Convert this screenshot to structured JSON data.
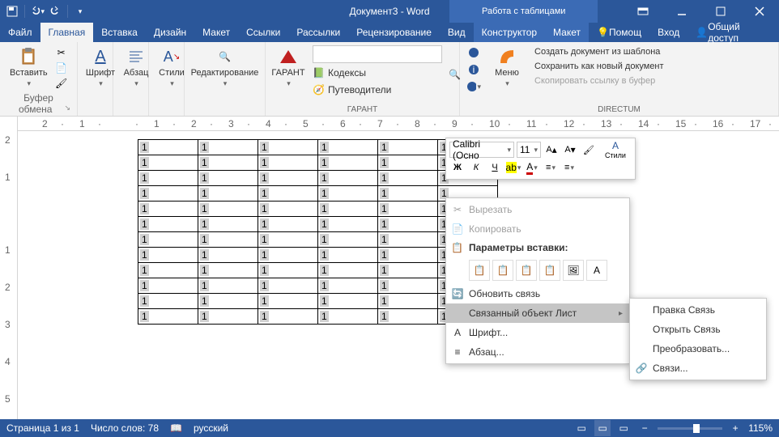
{
  "titlebar": {
    "title": "Документ3 - Word",
    "context_title": "Работа с таблицами"
  },
  "tabs": {
    "file": "Файл",
    "home": "Главная",
    "insert": "Вставка",
    "design": "Дизайн",
    "layout": "Макет",
    "refs": "Ссылки",
    "mailings": "Рассылки",
    "review": "Рецензирование",
    "view": "Вид",
    "constructor": "Конструктор",
    "tlayout": "Макет",
    "help": "Помощ",
    "login": "Вход",
    "share": "Общий доступ"
  },
  "ribbon": {
    "clipboard": {
      "label": "Буфер обмена",
      "paste": "Вставить"
    },
    "font": {
      "label": "Шрифт"
    },
    "para": {
      "label": "Абзац"
    },
    "styles": {
      "label": "Стили"
    },
    "editing": {
      "label": "Редактирование"
    },
    "garant": {
      "label": "ГАРАНТ",
      "btn": "ГАРАНТ",
      "kodeksy": "Кодексы",
      "guides": "Путеводители"
    },
    "directum": {
      "label": "DIRECTUM",
      "menu": "Меню",
      "create": "Создать документ из шаблона",
      "save_new": "Сохранить как новый документ",
      "copy_link": "Скопировать ссылку в буфер"
    }
  },
  "mini": {
    "font": "Calibri (Осно",
    "size": "11",
    "styles": "Стили",
    "bold": "Ж",
    "italic": "К",
    "underline": "Ч"
  },
  "ctx": {
    "cut": "Вырезать",
    "copy": "Копировать",
    "paste_header": "Параметры вставки:",
    "update": "Обновить связь",
    "linked": "Связанный объект Лист",
    "font_m": "Шрифт...",
    "para_m": "Абзац..."
  },
  "submenu": {
    "edit": "Правка Связь",
    "open": "Открыть Связь",
    "convert": "Преобразовать...",
    "links": "Связи..."
  },
  "status": {
    "page": "Страница 1 из 1",
    "words": "Число слов: 78",
    "lang": "русский",
    "zoom": "115%"
  },
  "chart_data": {
    "type": "table",
    "rows": 12,
    "cols": 6,
    "values": [
      [
        "1",
        "1",
        "1",
        "1",
        "1",
        "1"
      ],
      [
        "1",
        "1",
        "1",
        "1",
        "1",
        "1"
      ],
      [
        "1",
        "1",
        "1",
        "1",
        "1",
        "1"
      ],
      [
        "1",
        "1",
        "1",
        "1",
        "1",
        "1"
      ],
      [
        "1",
        "1",
        "1",
        "1",
        "1",
        "1"
      ],
      [
        "1",
        "1",
        "1",
        "1",
        "1",
        "1"
      ],
      [
        "1",
        "1",
        "1",
        "1",
        "1",
        "1"
      ],
      [
        "1",
        "1",
        "1",
        "1",
        "1",
        "1"
      ],
      [
        "1",
        "1",
        "1",
        "1",
        "1",
        "1"
      ],
      [
        "1",
        "1",
        "1",
        "1",
        "1",
        "1"
      ],
      [
        "1",
        "1",
        "1",
        "1",
        "1",
        "1"
      ],
      [
        "1",
        "1",
        "1",
        "1",
        "1",
        "1"
      ]
    ]
  },
  "ruler_marks": [
    "2",
    "1",
    "",
    "1",
    "2",
    "3",
    "4",
    "5",
    "6",
    "7",
    "8",
    "9",
    "10",
    "11",
    "12",
    "13",
    "14",
    "15",
    "16",
    "17"
  ]
}
